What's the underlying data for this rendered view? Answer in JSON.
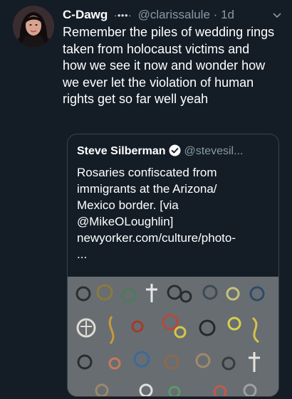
{
  "tweet": {
    "display_name": "C-Dawg",
    "name_decoration": "·•••·",
    "handle": "@clarissalule",
    "separator": "·",
    "time": "1d",
    "text": "Remember the piles of wedding rings taken from holocaust victims and how we see it now and wonder how we ever let the violation of human rights get so far well yeah"
  },
  "quoted_tweet": {
    "display_name": "Steve Silberman",
    "handle": "@stevesil...",
    "text_lines": [
      "Rosaries confiscated from",
      "immigrants at the Arizona/",
      "Mexico border. [via",
      "@MikeOLoughlin]",
      "newyorker.com/culture/photo-",
      "..."
    ]
  },
  "icons": {
    "menu": "chevron-down-icon",
    "verified": "verified-badge-icon"
  },
  "colors": {
    "background": "#141d26",
    "secondary_text": "#8899a6",
    "verified_blue": "#1da1f2",
    "border": "#38444d"
  }
}
